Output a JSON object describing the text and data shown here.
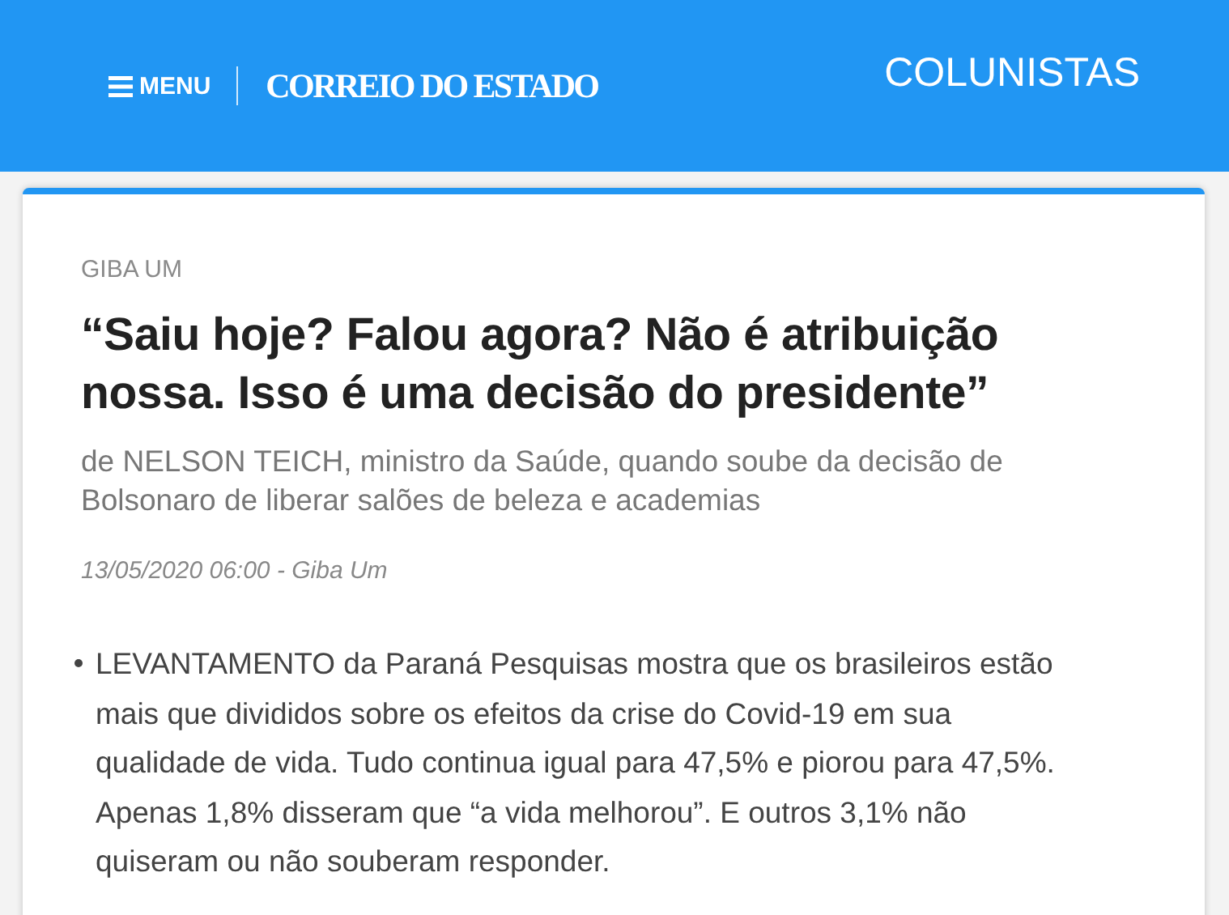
{
  "header": {
    "menu_label": "MENU",
    "logo": "CORREIO DO ESTADO",
    "section": "COLUNISTAS"
  },
  "article": {
    "column": "GIBA UM",
    "title": "“Saiu hoje? Falou agora? Não é atribuição nossa. Isso é uma decisão do presidente”",
    "subtitle": "de NELSON TEICH, ministro da Saúde, quando soube da decisão de Bolsonaro de liberar salões de beleza e academias",
    "meta": "13/05/2020 06:00 - Giba Um",
    "bullets": [
      "LEVANTAMENTO da Paraná Pesquisas mostra que os brasileiros estão mais que divididos sobre os efeitos da crise do Covid-19 em sua qualidade de vida. Tudo continua igual para 47,5% e piorou para 47,5%. Apenas 1,8% disseram que “a vida melhorou”. E outros 3,1% não quiseram ou não souberam responder."
    ]
  }
}
